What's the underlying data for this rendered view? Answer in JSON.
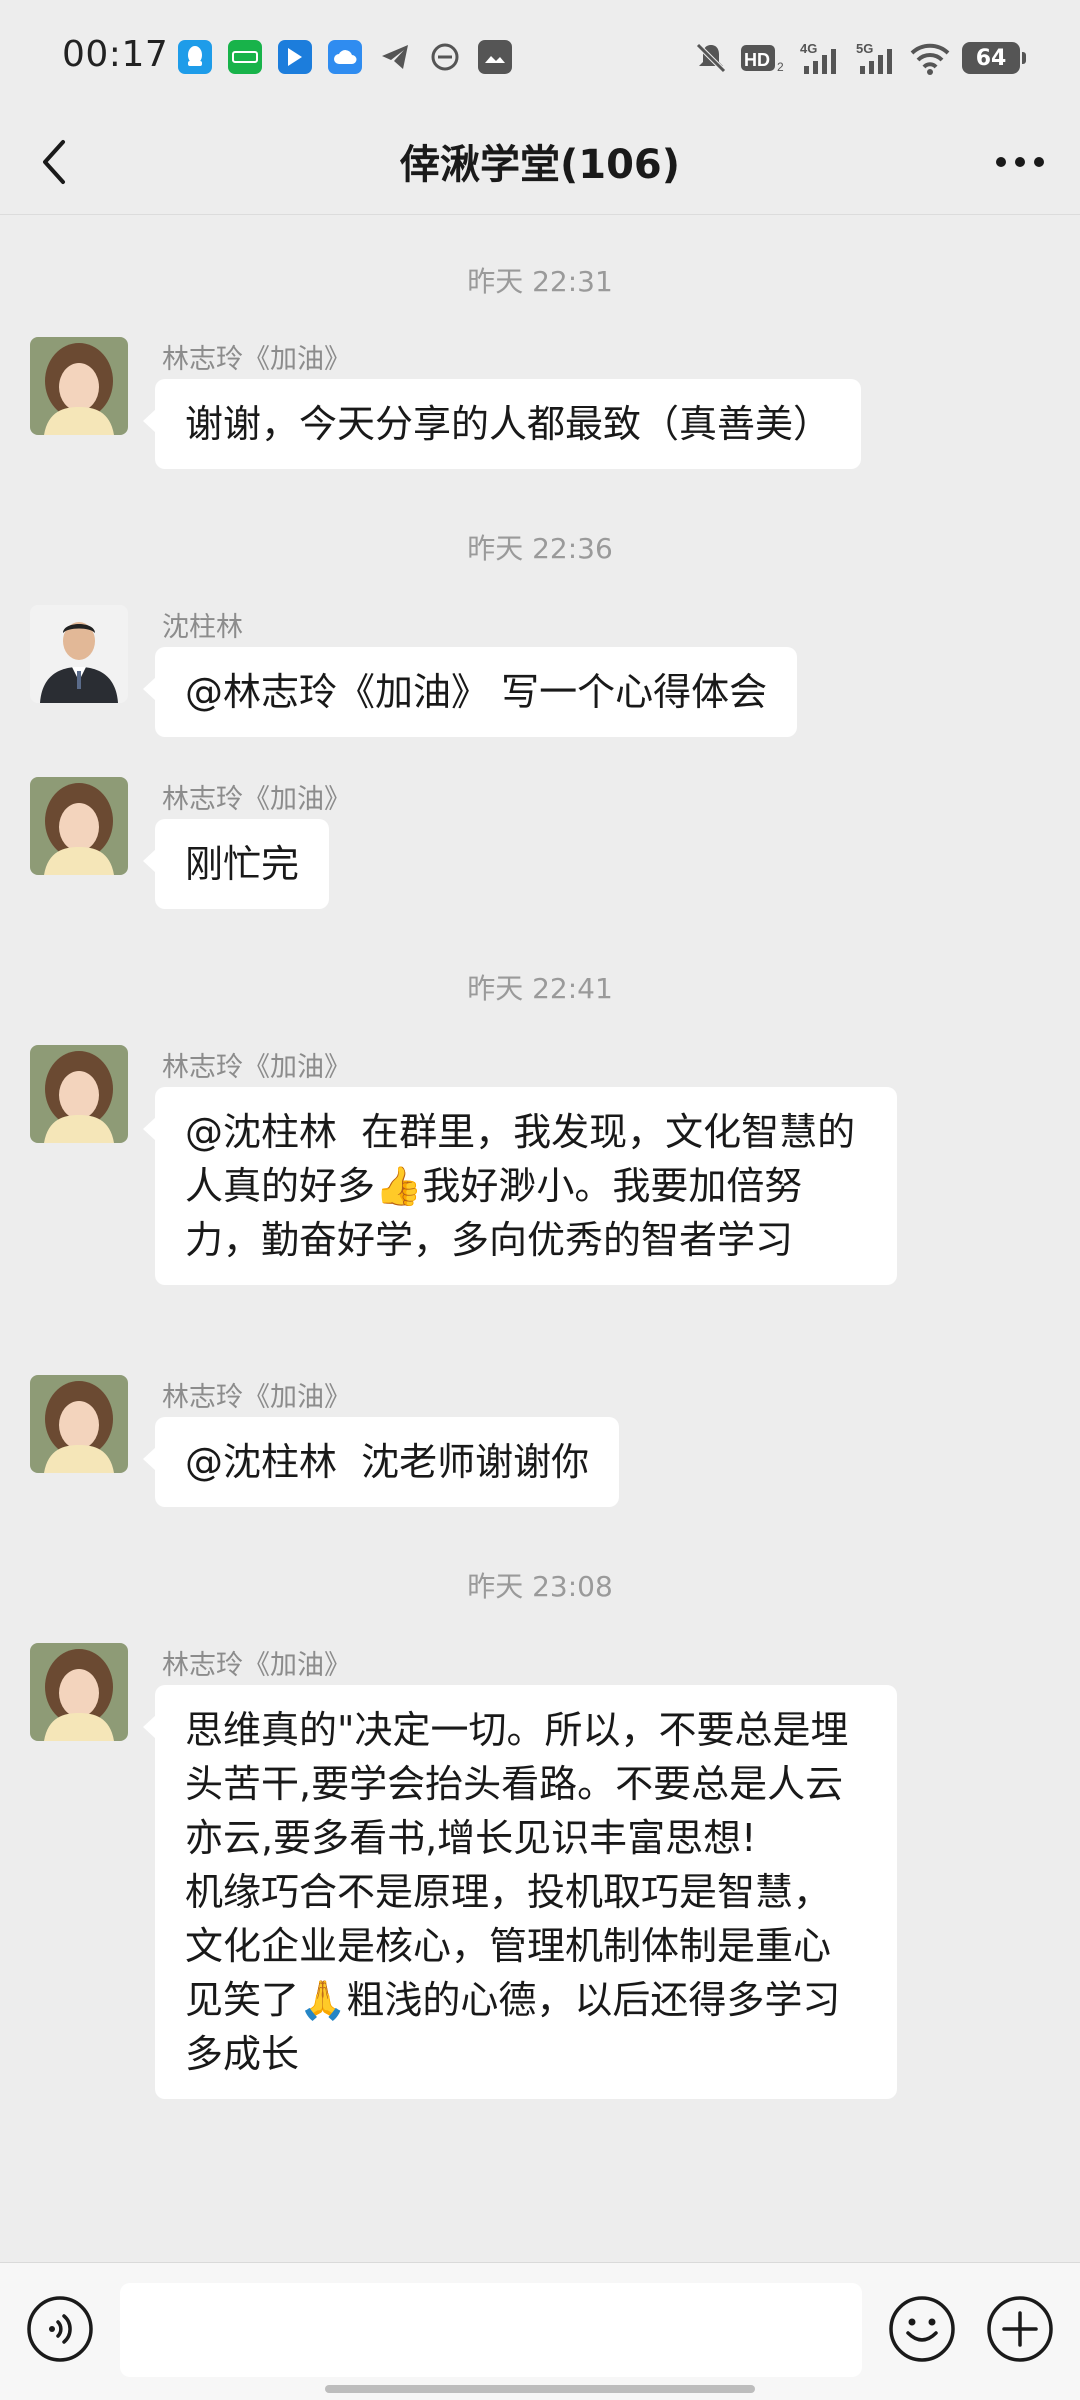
{
  "status_bar": {
    "time": "00:17",
    "battery": "64",
    "app_icons": [
      "qq-icon",
      "iqiyi-icon",
      "maps-icon",
      "cloud-icon",
      "telegram-icon",
      "dnd-icon",
      "photos-icon"
    ],
    "status_icons": [
      "mute-icon",
      "hd-icon",
      "signal-4g-icon",
      "signal-5g-icon",
      "wifi-icon"
    ]
  },
  "header": {
    "title": "倖湫学堂(106)"
  },
  "chat": {
    "ts1": "昨天 22:31",
    "ts2": "昨天 22:36",
    "ts3": "昨天 22:41",
    "ts4": "昨天 23:08",
    "messages": [
      {
        "sender": "林志玲《加油》",
        "text": "谢谢，今天分享的人都最致（真善美）"
      },
      {
        "sender": "沈柱林",
        "text": "@林志玲《加油》 写一个心得体会"
      },
      {
        "sender": "林志玲《加油》",
        "text": "刚忙完"
      },
      {
        "sender": "林志玲《加油》",
        "text": "@沈柱林  在群里，我发现，文化智慧的人真的好多👍我好渺小。我要加倍努力，勤奋好学，多向优秀的智者学习"
      },
      {
        "sender": "林志玲《加油》",
        "text": "@沈柱林  沈老师谢谢你"
      },
      {
        "sender": "林志玲《加油》",
        "text": "思维真的\"决定一切。所以，不要总是埋头苦干,要学会抬头看路。不要总是人云亦云,要多看书,增长见识丰富思想!\n机缘巧合不是原理，投机取巧是智慧，文化企业是核心，管理机制体制是重心\n见笑了🙏粗浅的心德，以后还得多学习多成长"
      }
    ]
  },
  "input_bar": {
    "placeholder": "",
    "value": ""
  },
  "colors": {
    "background": "#ededed",
    "bubble": "#ffffff",
    "timestamp": "#9a9a9a",
    "sender_name": "#8c8c8c"
  }
}
